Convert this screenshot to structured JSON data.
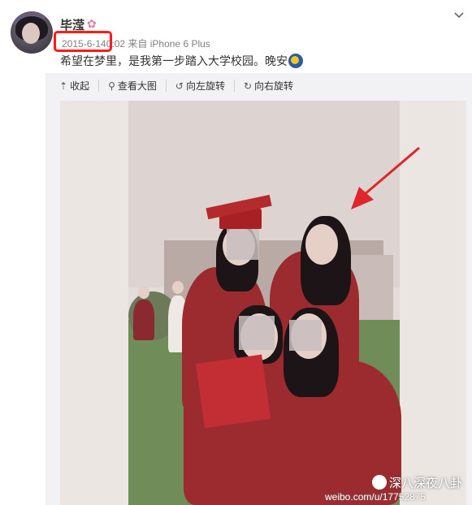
{
  "post": {
    "username": "毕滢",
    "date": "2015-6-14",
    "time_source": "0:02 来自 iPhone 6 Plus",
    "text": "希望在梦里，是我第一步踏入大学校园。晚安"
  },
  "toolbar": {
    "collapse": "收起",
    "view_large": "查看大图",
    "rotate_left": "向左旋转",
    "rotate_right": "向右旋转"
  },
  "watermark": {
    "account": "深八深夜八卦",
    "url": "weibo.com/u/17752875"
  },
  "icons": {
    "verified_badge": "butterfly-icon",
    "moon_emoji": "moon-icon",
    "menu": "chevron-down-icon"
  },
  "colors": {
    "highlight": "#ff1a1a",
    "arrow": "#e0262b"
  }
}
